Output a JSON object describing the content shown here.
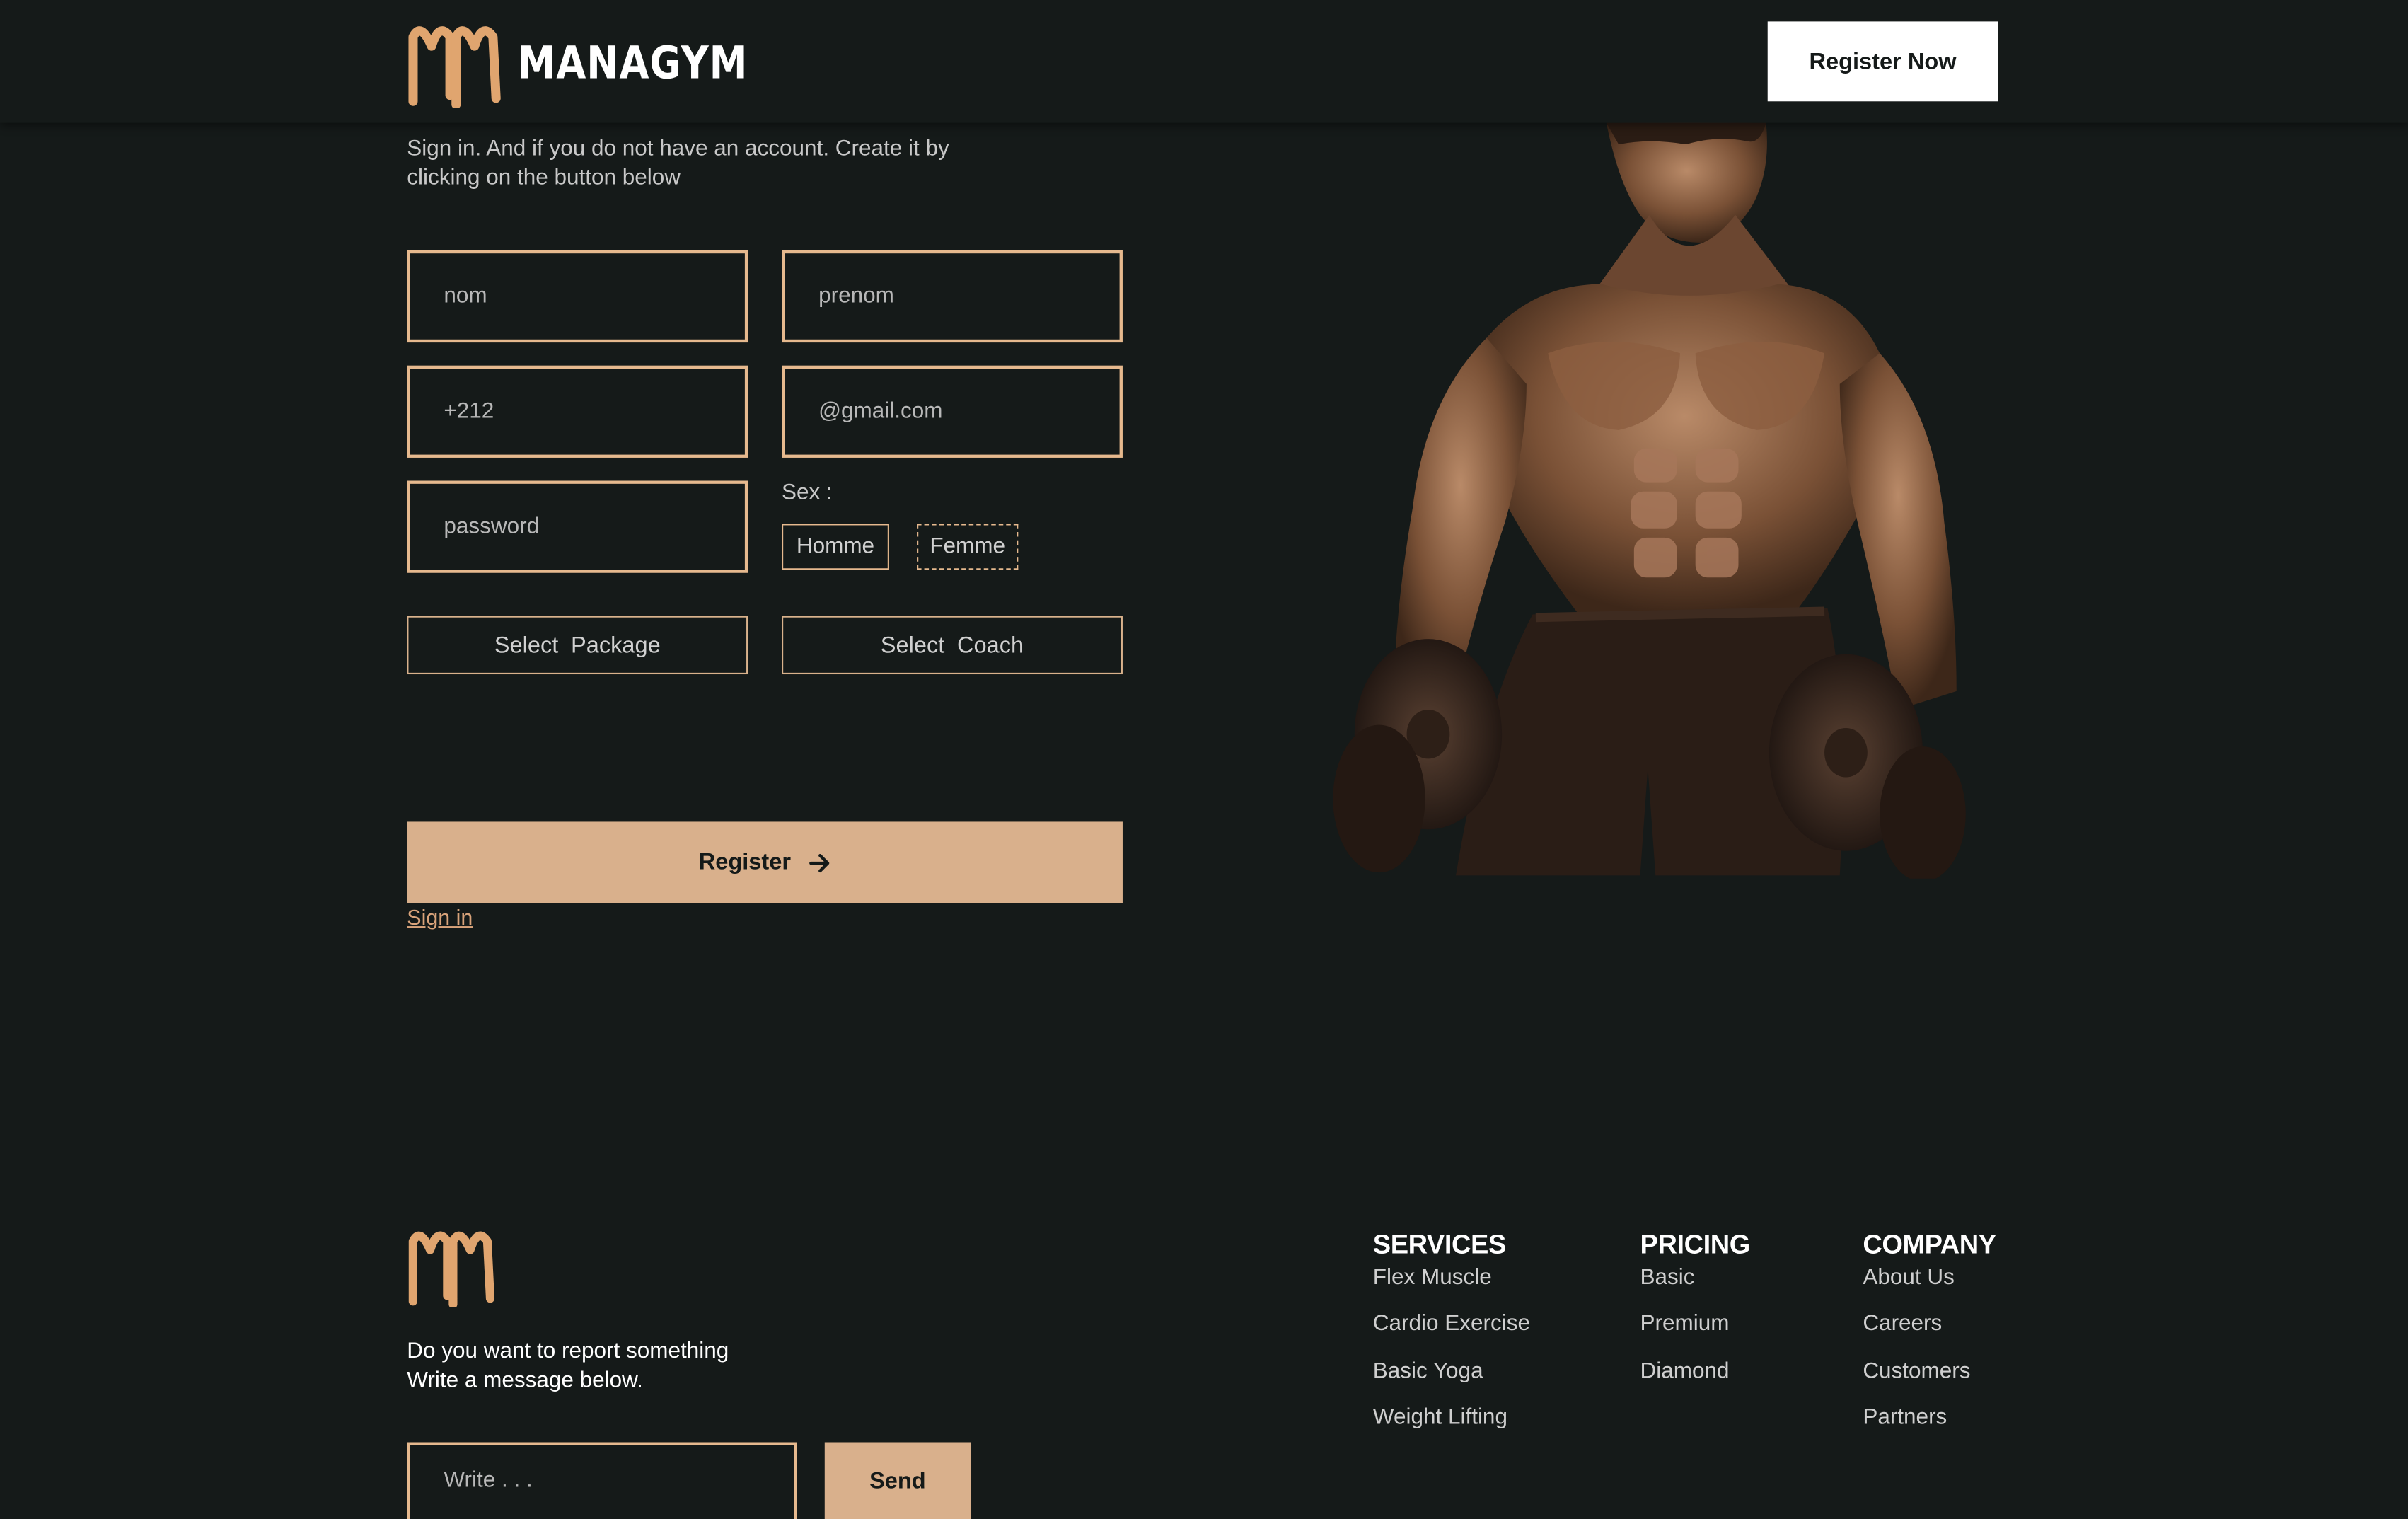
{
  "header": {
    "brand": "MANAGYM",
    "register_now": "Register Now"
  },
  "form": {
    "intro": "Sign in. And if you do not have an account. Create it by clicking on the button below",
    "nom_placeholder": "nom",
    "prenom_placeholder": "prenom",
    "phone_placeholder": "+212",
    "email_placeholder": "@gmail.com",
    "password_placeholder": "password",
    "sex_label": "Sex :",
    "sex_options": [
      "Homme",
      "Femme"
    ],
    "select_package": "Select  Package",
    "select_coach": "Select  Coach",
    "register": "Register",
    "sign_in": "Sign in"
  },
  "footer": {
    "report_line1": "Do you want to report something",
    "report_line2": "Write a message below.",
    "write_placeholder": "Write . . .",
    "send": "Send",
    "columns": [
      {
        "title": "SERVICES",
        "links": [
          "Flex Muscle",
          "Cardio Exercise",
          "Basic Yoga",
          "Weight Lifting"
        ]
      },
      {
        "title": "PRICING",
        "links": [
          "Basic",
          "Premium",
          "Diamond"
        ]
      },
      {
        "title": "COMPANY",
        "links": [
          "About Us",
          "Careers",
          "Customers",
          "Partners"
        ]
      }
    ]
  },
  "colors": {
    "background": "#151a19",
    "accent": "#d9b08c",
    "accent_border": "#e6b98e",
    "logo": "#e0a56f"
  },
  "icons": [
    "mm-logo-icon",
    "arrow-right-icon",
    "bodybuilder-image"
  ]
}
